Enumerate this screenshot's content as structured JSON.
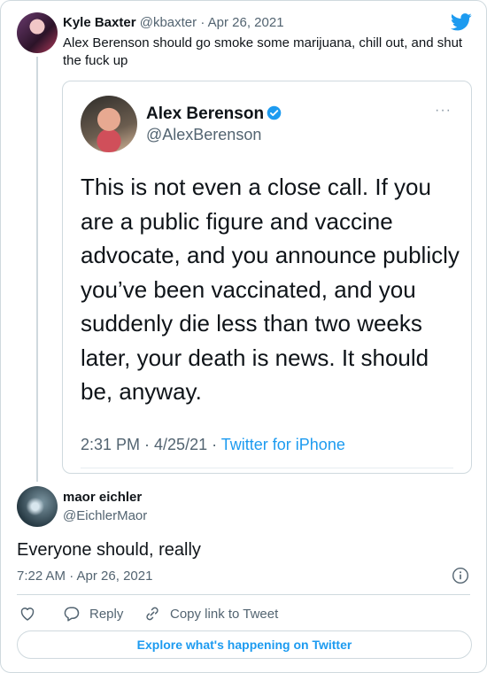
{
  "reply": {
    "name": "Kyle Baxter",
    "handle": "@kbaxter",
    "separator": "·",
    "date": "Apr 26, 2021",
    "text": "Alex Berenson should go smoke some marijuana, chill out, and shut the fuck up",
    "avatar": "user-avatar",
    "logo": "twitter-bird-icon"
  },
  "embedded": {
    "name": "Alex Berenson",
    "handle": "@AlexBerenson",
    "text": "This is not even a close call. If you are a public figure and vaccine advocate, and you announce publicly you’ve been vaccinated, and you suddenly die less than two weeks later, your death is news. It should be, anyway.",
    "time": "2:31 PM · 4/25/21 ·",
    "source": "Twitter for iPhone",
    "more": "···"
  },
  "tweet": {
    "name": "maor eichler",
    "handle": "@EichlerMaor",
    "text": "Everyone should, really",
    "timestamp": "7:22 AM · Apr 26, 2021"
  },
  "actions": {
    "like_label": "",
    "reply_label": "Reply",
    "copy_label": "Copy link to Tweet"
  },
  "footer": {
    "explore_label": "Explore what's happening on Twitter"
  },
  "colors": {
    "accent": "#1d9bf0",
    "muted": "#536471",
    "border": "#cfd9de"
  }
}
